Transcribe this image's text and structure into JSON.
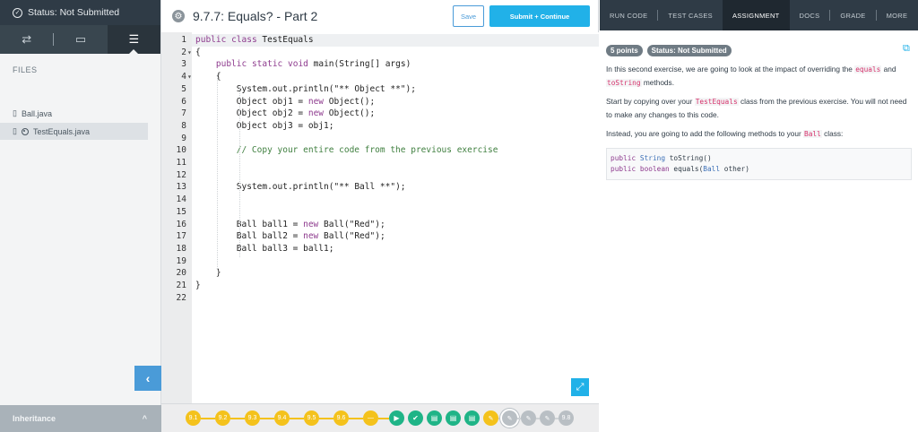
{
  "sidebar": {
    "status": "Status: Not Submitted",
    "files_label": "FILES",
    "files": [
      {
        "name": "Ball.java"
      },
      {
        "name": "TestEquals.java"
      }
    ],
    "footer_label": "Inheritance"
  },
  "editor": {
    "title": "9.7.7: Equals? - Part 2",
    "save_label": "Save",
    "submit_label": "Submit + Continue",
    "lines": [
      "public class TestEquals",
      "{",
      "    public static void main(String[] args)",
      "    {",
      "        System.out.println(\"** Object **\");",
      "        Object obj1 = new Object();",
      "        Object obj2 = new Object();",
      "        Object obj3 = obj1;",
      "",
      "        // Copy your entire code from the previous exercise",
      "",
      "",
      "        System.out.println(\"** Ball **\");",
      "",
      "",
      "        Ball ball1 = new Ball(\"Red\");",
      "        Ball ball2 = new Ball(\"Red\");",
      "        Ball ball3 = ball1;",
      "",
      "    }",
      "}",
      ""
    ],
    "line_numbers": [
      "1",
      "2",
      "3",
      "4",
      "5",
      "6",
      "7",
      "8",
      "9",
      "10",
      "11",
      "12",
      "13",
      "14",
      "15",
      "16",
      "17",
      "18",
      "19",
      "20",
      "21",
      "22"
    ]
  },
  "progress": {
    "nodes": [
      "9.1",
      "9.2",
      "9.3",
      "9.4",
      "9.5",
      "9.6"
    ],
    "last_node": "9.8"
  },
  "right_panel": {
    "nav": [
      "RUN CODE",
      "TEST CASES",
      "ASSIGNMENT",
      "DOCS",
      "GRADE",
      "MORE"
    ],
    "active_tab": "ASSIGNMENT",
    "points_badge": "5 points",
    "status_badge": "Status: Not Submitted",
    "p1_a": "In this second exercise, we are going to look at the impact of overriding the",
    "p1_code1": "equals",
    "p1_and": "and",
    "p1_code2": "toString",
    "p1_b": "methods.",
    "p2_a": "Start by copying over your",
    "p2_code": "TestEquals",
    "p2_b": "class from the previous exercise. You will not need to make any changes to this code.",
    "p3_a": "Instead, you are going to add the following methods to your",
    "p3_code": "Ball",
    "p3_b": "class:",
    "code_block": [
      "public String toString()",
      "public boolean equals(Ball other)"
    ]
  }
}
